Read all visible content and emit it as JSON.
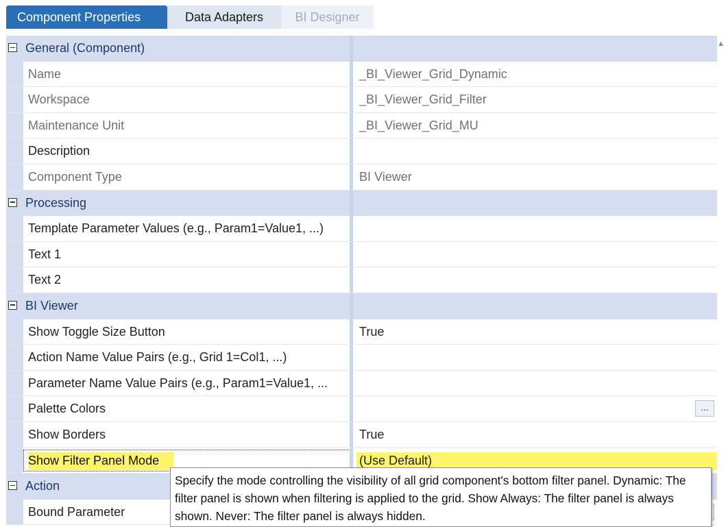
{
  "tabs": [
    {
      "label": "Component Properties",
      "state": "active"
    },
    {
      "label": "Data Adapters",
      "state": "normal"
    },
    {
      "label": "BI Designer",
      "state": "disabled"
    }
  ],
  "categories": {
    "general": "General (Component)",
    "processing": "Processing",
    "bi_viewer": "BI Viewer",
    "action": "Action"
  },
  "general": {
    "name": {
      "label": "Name",
      "value": "_BI_Viewer_Grid_Dynamic"
    },
    "workspace": {
      "label": "Workspace",
      "value": "_BI_Viewer_Grid_Filter"
    },
    "maintenance_unit": {
      "label": "Maintenance Unit",
      "value": "_BI_Viewer_Grid_MU"
    },
    "description": {
      "label": "Description",
      "value": ""
    },
    "component_type": {
      "label": "Component Type",
      "value": "BI Viewer"
    }
  },
  "processing": {
    "template_params": {
      "label": "Template Parameter Values (e.g., Param1=Value1, ...)",
      "value": ""
    },
    "text1": {
      "label": "Text 1",
      "value": ""
    },
    "text2": {
      "label": "Text 2",
      "value": ""
    }
  },
  "bi_viewer": {
    "show_toggle": {
      "label": "Show Toggle Size Button",
      "value": "True"
    },
    "action_pairs": {
      "label": "Action Name Value Pairs (e.g., Grid 1=Col1, ...)",
      "value": ""
    },
    "parameter_pairs": {
      "label": "Parameter Name Value Pairs (e.g., Param1=Value1, ...",
      "value": ""
    },
    "palette_colors": {
      "label": "Palette Colors",
      "value": "",
      "button": "..."
    },
    "show_borders": {
      "label": "Show Borders",
      "value": "True"
    },
    "show_filter_panel": {
      "label": "Show Filter Panel Mode",
      "value": "(Use Default)"
    }
  },
  "action": {
    "bound_parameter": {
      "label": "Bound Parameter",
      "value": "",
      "button": "..."
    }
  },
  "tooltip": {
    "text": "Specify the mode controlling the visibility of all grid component's bottom filter panel. Dynamic: The filter panel is shown when filtering is applied to the grid. Show Always: The filter panel is always shown. Never: The filter panel is always hidden."
  },
  "colors": {
    "tab_active": "#2a6fb5",
    "category_bg": "#d4def0",
    "highlight": "#fff56a"
  }
}
